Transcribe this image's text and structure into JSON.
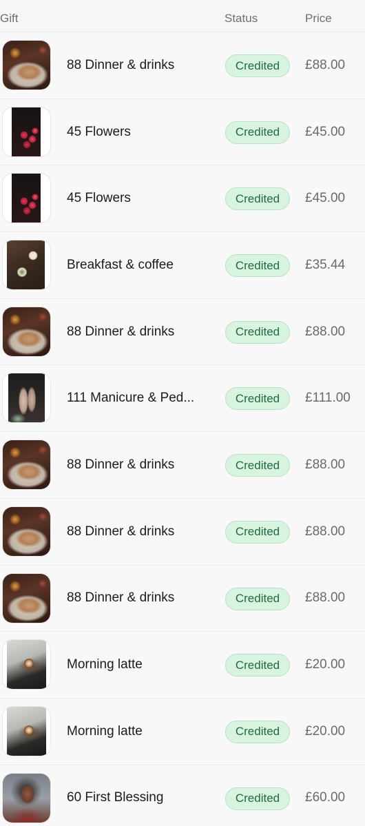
{
  "table": {
    "headers": {
      "gift": "Gift",
      "status": "Status",
      "price": "Price"
    },
    "rows": [
      {
        "thumbnail": "dinner-photo",
        "name": "88 Dinner & drinks",
        "status": "Credited",
        "price": "£88.00"
      },
      {
        "thumbnail": "flowers-photo",
        "name": "45 Flowers",
        "status": "Credited",
        "price": "£45.00"
      },
      {
        "thumbnail": "flowers-photo",
        "name": "45 Flowers",
        "status": "Credited",
        "price": "£45.00"
      },
      {
        "thumbnail": "breakfast-photo",
        "name": "Breakfast & coffee",
        "status": "Credited",
        "price": "£35.44"
      },
      {
        "thumbnail": "dinner-photo",
        "name": "88 Dinner & drinks",
        "status": "Credited",
        "price": "£88.00"
      },
      {
        "thumbnail": "manicure-photo",
        "name": "111 Manicure & Ped...",
        "status": "Credited",
        "price": "£111.00"
      },
      {
        "thumbnail": "dinner-photo",
        "name": "88 Dinner & drinks",
        "status": "Credited",
        "price": "£88.00"
      },
      {
        "thumbnail": "dinner-photo",
        "name": "88 Dinner & drinks",
        "status": "Credited",
        "price": "£88.00"
      },
      {
        "thumbnail": "dinner-photo",
        "name": "88 Dinner & drinks",
        "status": "Credited",
        "price": "£88.00"
      },
      {
        "thumbnail": "latte-photo",
        "name": "Morning latte",
        "status": "Credited",
        "price": "£20.00"
      },
      {
        "thumbnail": "latte-photo",
        "name": "Morning latte",
        "status": "Credited",
        "price": "£20.00"
      },
      {
        "thumbnail": "blessing-photo",
        "name": "60 First Blessing",
        "status": "Credited",
        "price": "£60.00"
      }
    ]
  },
  "colors": {
    "badge_bg": "#d8f3e0",
    "badge_text": "#1f6b3d",
    "background": "#f6f6f6"
  }
}
